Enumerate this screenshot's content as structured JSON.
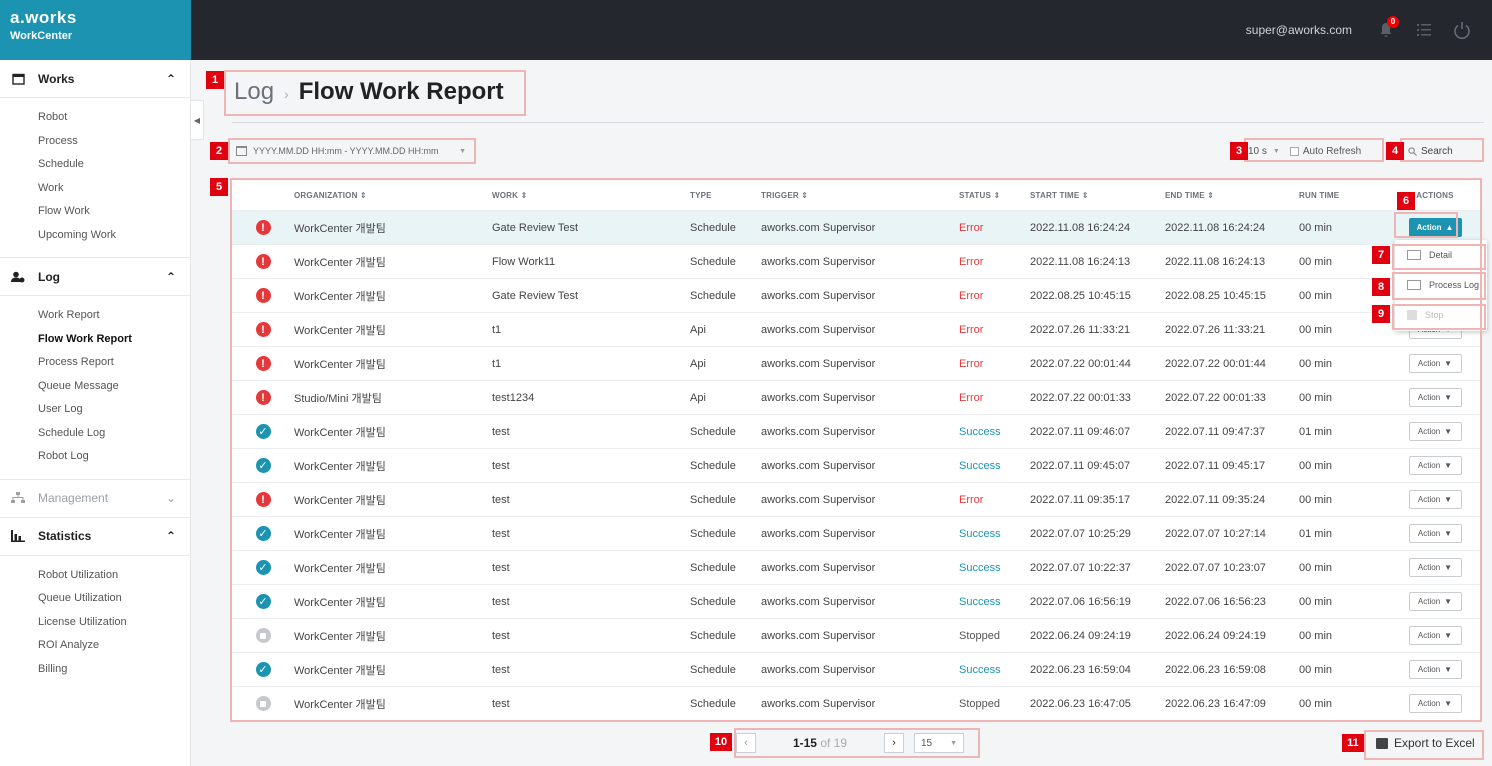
{
  "brand": {
    "logo": "a.works",
    "sub": "WorkCenter"
  },
  "topbar": {
    "email": "super@aworks.com",
    "notification_count": "0"
  },
  "sidebar": {
    "groups": [
      {
        "title": "Works",
        "items": [
          "Robot",
          "Process",
          "Schedule",
          "Work",
          "Flow Work",
          "Upcoming Work"
        ]
      },
      {
        "title": "Log",
        "items": [
          "Work Report",
          "Flow Work Report",
          "Process Report",
          "Queue Message",
          "User Log",
          "Schedule Log",
          "Robot Log"
        ]
      },
      {
        "title": "Management",
        "items": []
      },
      {
        "title": "Statistics",
        "items": [
          "Robot Utilization",
          "Queue Utilization",
          "License Utilization",
          "ROI Analyze",
          "Billing"
        ]
      }
    ]
  },
  "page": {
    "breadcrumb": "Log",
    "title": "Flow Work Report"
  },
  "filters": {
    "date_placeholder": "YYYY.MM.DD HH:mm - YYYY.MM.DD HH:mm",
    "refresh_interval": "10 s",
    "auto_refresh_label": "Auto Refresh",
    "search_label": "Search"
  },
  "table": {
    "headers": {
      "organization": "ORGANIZATION",
      "work": "WORK",
      "type": "TYPE",
      "trigger": "TRIGGER",
      "status": "STATUS",
      "start": "START TIME",
      "end": "END TIME",
      "run": "RUN TIME",
      "actions": "ACTIONS"
    },
    "sortable_mark": "⇕",
    "action_label": "Action",
    "rows": [
      {
        "state": "err",
        "org": "WorkCenter 개발팀",
        "work": "Gate Review Test",
        "type": "Schedule",
        "trigger": "aworks.com Supervisor",
        "status": "Error",
        "start": "2022.11.08 16:24:24",
        "end": "2022.11.08 16:24:24",
        "run": "00 min"
      },
      {
        "state": "err",
        "org": "WorkCenter 개발팀",
        "work": "Flow Work11",
        "type": "Schedule",
        "trigger": "aworks.com Supervisor",
        "status": "Error",
        "start": "2022.11.08 16:24:13",
        "end": "2022.11.08 16:24:13",
        "run": "00 min"
      },
      {
        "state": "err",
        "org": "WorkCenter 개발팀",
        "work": "Gate Review Test",
        "type": "Schedule",
        "trigger": "aworks.com Supervisor",
        "status": "Error",
        "start": "2022.08.25 10:45:15",
        "end": "2022.08.25 10:45:15",
        "run": "00 min"
      },
      {
        "state": "err",
        "org": "WorkCenter 개발팀",
        "work": "t1",
        "type": "Api",
        "trigger": "aworks.com Supervisor",
        "status": "Error",
        "start": "2022.07.26 11:33:21",
        "end": "2022.07.26 11:33:21",
        "run": "00 min"
      },
      {
        "state": "err",
        "org": "WorkCenter 개발팀",
        "work": "t1",
        "type": "Api",
        "trigger": "aworks.com Supervisor",
        "status": "Error",
        "start": "2022.07.22 00:01:44",
        "end": "2022.07.22 00:01:44",
        "run": "00 min"
      },
      {
        "state": "err",
        "org": "Studio/Mini 개발팀",
        "work": "test1234",
        "type": "Api",
        "trigger": "aworks.com Supervisor",
        "status": "Error",
        "start": "2022.07.22 00:01:33",
        "end": "2022.07.22 00:01:33",
        "run": "00 min"
      },
      {
        "state": "ok",
        "org": "WorkCenter 개발팀",
        "work": "test",
        "type": "Schedule",
        "trigger": "aworks.com Supervisor",
        "status": "Success",
        "start": "2022.07.11 09:46:07",
        "end": "2022.07.11 09:47:37",
        "run": "01 min"
      },
      {
        "state": "ok",
        "org": "WorkCenter 개발팀",
        "work": "test",
        "type": "Schedule",
        "trigger": "aworks.com Supervisor",
        "status": "Success",
        "start": "2022.07.11 09:45:07",
        "end": "2022.07.11 09:45:17",
        "run": "00 min"
      },
      {
        "state": "err",
        "org": "WorkCenter 개발팀",
        "work": "test",
        "type": "Schedule",
        "trigger": "aworks.com Supervisor",
        "status": "Error",
        "start": "2022.07.11 09:35:17",
        "end": "2022.07.11 09:35:24",
        "run": "00 min"
      },
      {
        "state": "ok",
        "org": "WorkCenter 개발팀",
        "work": "test",
        "type": "Schedule",
        "trigger": "aworks.com Supervisor",
        "status": "Success",
        "start": "2022.07.07 10:25:29",
        "end": "2022.07.07 10:27:14",
        "run": "01 min"
      },
      {
        "state": "ok",
        "org": "WorkCenter 개발팀",
        "work": "test",
        "type": "Schedule",
        "trigger": "aworks.com Supervisor",
        "status": "Success",
        "start": "2022.07.07 10:22:37",
        "end": "2022.07.07 10:23:07",
        "run": "00 min"
      },
      {
        "state": "ok",
        "org": "WorkCenter 개발팀",
        "work": "test",
        "type": "Schedule",
        "trigger": "aworks.com Supervisor",
        "status": "Success",
        "start": "2022.07.06 16:56:19",
        "end": "2022.07.06 16:56:23",
        "run": "00 min"
      },
      {
        "state": "stop",
        "org": "WorkCenter 개발팀",
        "work": "test",
        "type": "Schedule",
        "trigger": "aworks.com Supervisor",
        "status": "Stopped",
        "start": "2022.06.24 09:24:19",
        "end": "2022.06.24 09:24:19",
        "run": "00 min"
      },
      {
        "state": "ok",
        "org": "WorkCenter 개발팀",
        "work": "test",
        "type": "Schedule",
        "trigger": "aworks.com Supervisor",
        "status": "Success",
        "start": "2022.06.23 16:59:04",
        "end": "2022.06.23 16:59:08",
        "run": "00 min"
      },
      {
        "state": "stop",
        "org": "WorkCenter 개발팀",
        "work": "test",
        "type": "Schedule",
        "trigger": "aworks.com Supervisor",
        "status": "Stopped",
        "start": "2022.06.23 16:47:05",
        "end": "2022.06.23 16:47:09",
        "run": "00 min"
      }
    ]
  },
  "action_menu": {
    "items": [
      "Detail",
      "Process Log",
      "Stop"
    ]
  },
  "pagination": {
    "range": "1-15",
    "of_total": "of 19",
    "page_size": "15"
  },
  "export": {
    "label": "Export to Excel"
  },
  "markers": [
    "1",
    "2",
    "3",
    "4",
    "5",
    "6",
    "7",
    "8",
    "9",
    "10",
    "11"
  ],
  "colors": {
    "brand": "#1b93b1",
    "topbar": "#24272e",
    "error": "#e5383b",
    "success": "#1b93b1",
    "marker": "#e1000f"
  }
}
